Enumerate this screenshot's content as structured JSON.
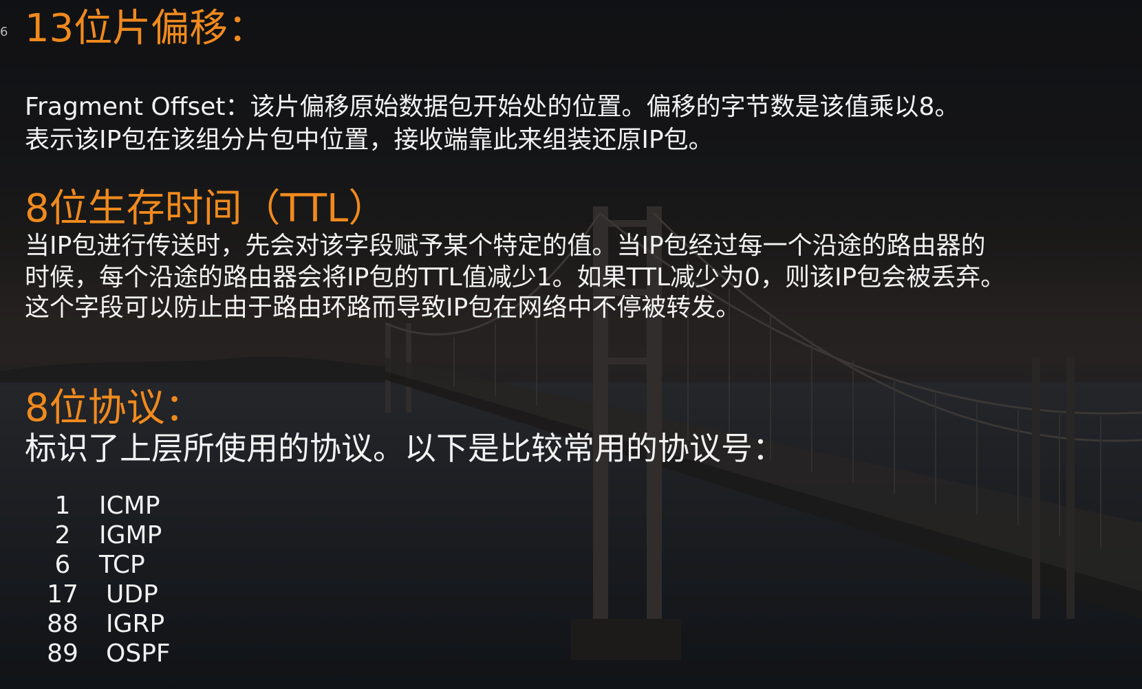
{
  "slide": {
    "number": "6"
  },
  "sections": {
    "fragment": {
      "heading": "13位片偏移：",
      "line1": "Fragment Offset：该片偏移原始数据包开始处的位置。偏移的字节数是该值乘以8。",
      "line2": "表示该IP包在该组分片包中位置，接收端靠此来组装还原IP包。"
    },
    "ttl": {
      "heading": "8位生存时间（TTL）",
      "line1": "当IP包进行传送时，先会对该字段赋予某个特定的值。当IP包经过每一个沿途的路由器的",
      "line2": "时候，每个沿途的路由器会将IP包的TTL值减少1。如果TTL减少为0，则该IP包会被丢弃。",
      "line3": "这个字段可以防止由于路由环路而导致IP包在网络中不停被转发。"
    },
    "protocol": {
      "heading": "8位协议：",
      "intro": "标识了上层所使用的协议。以下是比较常用的协议号：",
      "items": [
        {
          "num": "1",
          "name": "ICMP"
        },
        {
          "num": "2",
          "name": "IGMP"
        },
        {
          "num": "6",
          "name": "TCP"
        },
        {
          "num": "17",
          "name": "UDP"
        },
        {
          "num": "88",
          "name": "IGRP"
        },
        {
          "num": "89",
          "name": "OSPF"
        }
      ]
    }
  },
  "colors": {
    "heading": "#f08a1e",
    "text": "#f2f2f2",
    "background": "#1c1c1f"
  }
}
